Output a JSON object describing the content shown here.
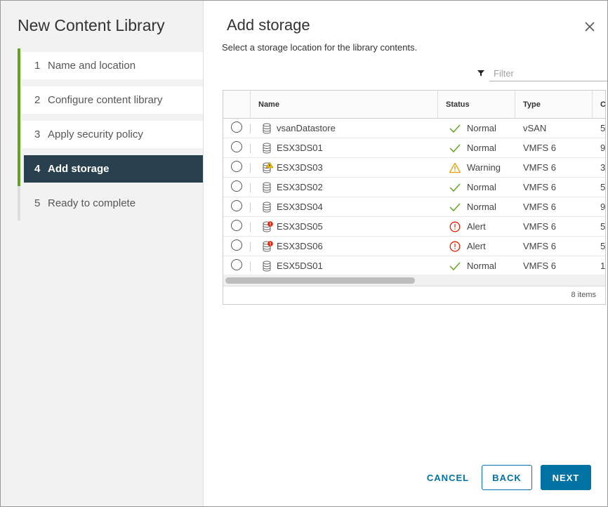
{
  "wizard": {
    "title": "New Content Library",
    "steps": [
      {
        "num": "1",
        "label": "Name and location",
        "state": "completed"
      },
      {
        "num": "2",
        "label": "Configure content library",
        "state": "completed"
      },
      {
        "num": "3",
        "label": "Apply security policy",
        "state": "completed"
      },
      {
        "num": "4",
        "label": "Add storage",
        "state": "active"
      },
      {
        "num": "5",
        "label": "Ready to complete",
        "state": "pending"
      }
    ]
  },
  "page": {
    "title": "Add storage",
    "subtitle": "Select a storage location for the library contents."
  },
  "filter": {
    "placeholder": "Filter",
    "value": ""
  },
  "grid": {
    "columns": [
      "Name",
      "Status",
      "Type",
      "C"
    ],
    "rows": [
      {
        "name": "vsanDatastore",
        "status": "Normal",
        "type": "vSAN",
        "capacity": "5",
        "icon": "datastore-icon",
        "status_icon": "check-icon"
      },
      {
        "name": "ESX3DS01",
        "status": "Normal",
        "type": "VMFS 6",
        "capacity": "9",
        "icon": "datastore-icon",
        "status_icon": "check-icon"
      },
      {
        "name": "ESX3DS03",
        "status": "Warning",
        "type": "VMFS 6",
        "capacity": "3",
        "icon": "datastore-warning-icon",
        "status_icon": "warning-icon"
      },
      {
        "name": "ESX3DS02",
        "status": "Normal",
        "type": "VMFS 6",
        "capacity": "5",
        "icon": "datastore-icon",
        "status_icon": "check-icon"
      },
      {
        "name": "ESX3DS04",
        "status": "Normal",
        "type": "VMFS 6",
        "capacity": "9",
        "icon": "datastore-icon",
        "status_icon": "check-icon"
      },
      {
        "name": "ESX3DS05",
        "status": "Alert",
        "type": "VMFS 6",
        "capacity": "5",
        "icon": "datastore-alert-icon",
        "status_icon": "alert-icon"
      },
      {
        "name": "ESX3DS06",
        "status": "Alert",
        "type": "VMFS 6",
        "capacity": "5",
        "icon": "datastore-alert-icon",
        "status_icon": "alert-icon"
      },
      {
        "name": "ESX5DS01",
        "status": "Normal",
        "type": "VMFS 6",
        "capacity": "1.",
        "icon": "datastore-icon",
        "status_icon": "check-icon"
      }
    ],
    "footer": "8 items"
  },
  "buttons": {
    "cancel": "CANCEL",
    "back": "BACK",
    "next": "NEXT"
  },
  "colors": {
    "accent": "#0072a3",
    "progress": "#62a420",
    "active_step": "#29414e",
    "normal": "#62a420",
    "warning": "#e0a100",
    "alert": "#e12200"
  }
}
